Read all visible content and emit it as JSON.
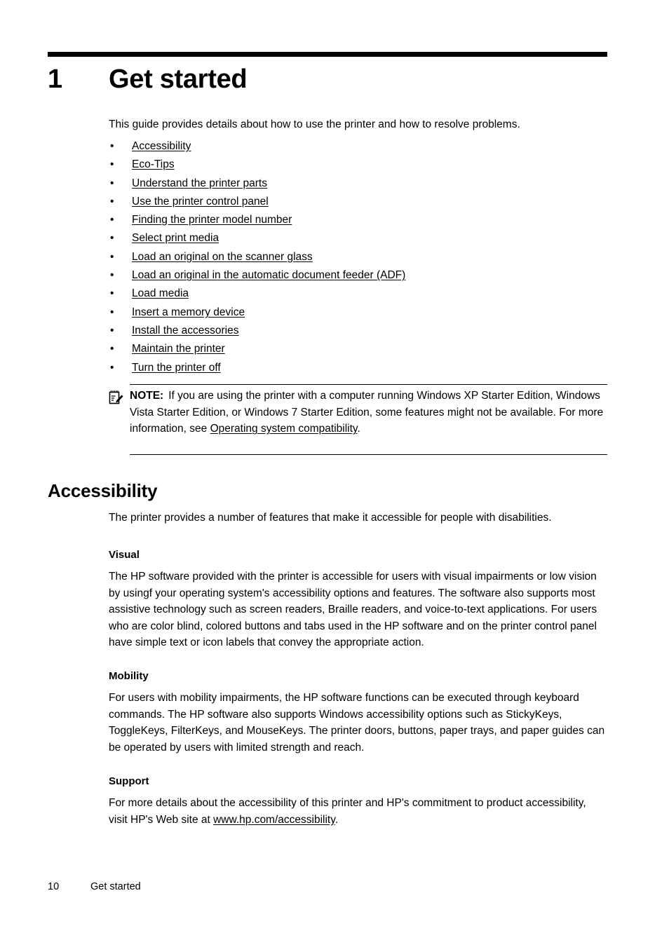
{
  "chapter": {
    "number": "1",
    "title": "Get started",
    "intro": "This guide provides details about how to use the printer and how to resolve problems."
  },
  "toc": {
    "bullet_glyph": "•",
    "items": [
      {
        "label": "Accessibility"
      },
      {
        "label": "Eco-Tips"
      },
      {
        "label": "Understand the printer parts"
      },
      {
        "label": "Use the printer control panel"
      },
      {
        "label": "Finding the printer model number"
      },
      {
        "label": "Select print media"
      },
      {
        "label": "Load an original on the scanner glass"
      },
      {
        "label": "Load an original in the automatic document feeder (ADF)"
      },
      {
        "label": "Load media"
      },
      {
        "label": "Insert a memory device"
      },
      {
        "label": "Install the accessories"
      },
      {
        "label": "Maintain the printer"
      },
      {
        "label": "Turn the printer off"
      }
    ]
  },
  "note": {
    "icon": "note-pad-pencil-icon",
    "label": "NOTE:",
    "text_before_link": "If you are using the printer with a computer running Windows XP Starter Edition, Windows Vista Starter Edition, or Windows 7 Starter Edition, some features might not be available. For more information, see ",
    "link": "Operating system compatibility",
    "text_after_link": "."
  },
  "accessibility": {
    "heading": "Accessibility",
    "intro": "The printer provides a number of features that make it accessible for people with disabilities.",
    "visual": {
      "heading": "Visual",
      "text": "The HP software provided with the printer is accessible for users with visual impairments or low vision by usingf your operating system's accessibility options and features. The software also supports most assistive technology such as screen readers, Braille readers, and voice-to-text applications. For users who are color blind, colored buttons and tabs used in the HP software and on the printer control panel have simple text or icon labels that convey the appropriate action."
    },
    "mobility": {
      "heading": "Mobility",
      "text": "For users with mobility impairments, the HP software functions can be executed through keyboard commands. The HP software also supports Windows accessibility options such as StickyKeys, ToggleKeys, FilterKeys, and MouseKeys. The printer doors, buttons, paper trays, and paper guides can be operated by users with limited strength and reach."
    },
    "support": {
      "heading": "Support",
      "text_before_link": "For more details about the accessibility of this printer and HP's commitment to product accessibility, visit HP's Web site at ",
      "link": "www.hp.com/accessibility",
      "text_after_link": "."
    }
  },
  "footer": {
    "page_number": "10",
    "chapter_name": "Get started"
  }
}
